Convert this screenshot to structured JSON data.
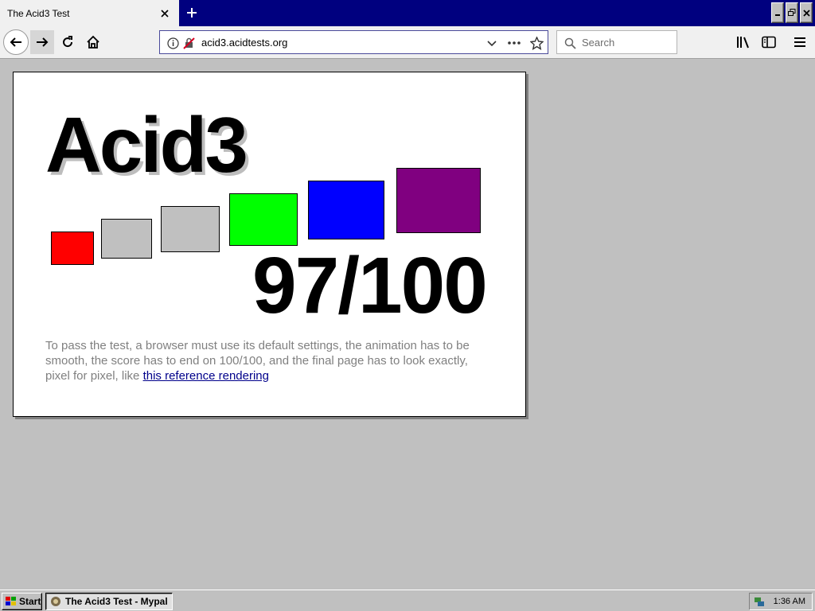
{
  "browser": {
    "tab_title": "The Acid3 Test",
    "url": "acid3.acidtests.org",
    "search_placeholder": "Search"
  },
  "page": {
    "title": "Acid3",
    "score": "97/100",
    "description_prefix": "To pass the test, a browser must use its default settings, the animation has to be smooth, the score has to end on 100/100, and the final page has to look exactly, pixel for pixel, like ",
    "reference_link": "this reference rendering",
    "buckets": [
      {
        "color": "#ff0000",
        "name": "bucket-1"
      },
      {
        "color": "#c0c0c0",
        "name": "bucket-2"
      },
      {
        "color": "#c0c0c0",
        "name": "bucket-3"
      },
      {
        "color": "#00ff00",
        "name": "bucket-4"
      },
      {
        "color": "#0000ff",
        "name": "bucket-5"
      },
      {
        "color": "#800080",
        "name": "bucket-6"
      }
    ]
  },
  "taskbar": {
    "start_label": "Start",
    "task_label": "The Acid3 Test - Mypal",
    "clock": "1:36 AM"
  },
  "colors": {
    "titlebar": "#00007f",
    "desktop": "#c0c0c0",
    "link": "#00008b"
  }
}
